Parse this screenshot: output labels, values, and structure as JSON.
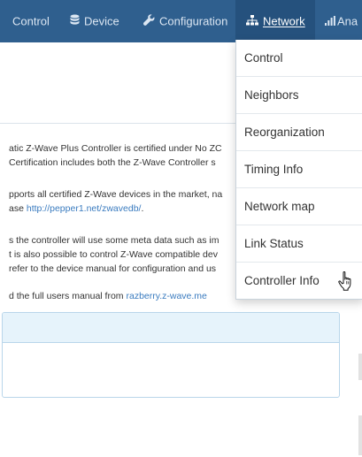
{
  "nav": {
    "control": "Control",
    "device": "Device",
    "configuration": "Configuration",
    "network": "Network",
    "analytics": "Ana"
  },
  "network_menu": {
    "items": [
      "Control",
      "Neighbors",
      "Reorganization",
      "Timing Info",
      "Network map",
      "Link Status",
      "Controller Info"
    ]
  },
  "content": {
    "p1_line1": "atic Z-Wave Plus Controller is certified under No ZC",
    "p1_line2": "Certification includes both the Z-Wave Controller s",
    "p2_line1": "pports all certified Z-Wave devices in the market, na",
    "p2_line2_prefix": "ase ",
    "p2_link": "http://pepper1.net/zwavedb/",
    "p2_line2_suffix": ".",
    "p3_line1": "s the controller will use some meta data such as im",
    "p3_line2": "t is also possible to control Z-Wave compatible dev",
    "p3_line3": "refer to the device manual for configuration and us",
    "p4_prefix": "d the full users manual from ",
    "p4_link": "razberry.z-wave.me"
  },
  "colors": {
    "navbar": "#2f5f8e",
    "navbar_active": "#25517d",
    "link": "#3a7bbf",
    "panel_header": "#e6f3fb"
  },
  "icons": {
    "device": "database-icon",
    "configuration": "wrench-icon",
    "network": "sitemap-icon",
    "analytics": "bar-chart-icon",
    "cursor": "hand-pointer-icon"
  }
}
